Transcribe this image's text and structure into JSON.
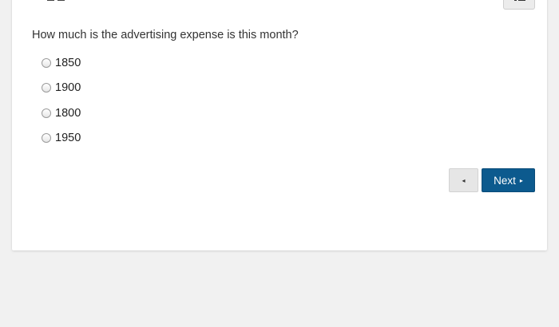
{
  "question": {
    "text": "How much is the advertising expense is this month?"
  },
  "options": [
    {
      "label": "1850",
      "selected": false
    },
    {
      "label": "1900",
      "selected": false
    },
    {
      "label": "1800",
      "selected": false
    },
    {
      "label": "1950",
      "selected": false
    }
  ],
  "navigation": {
    "prev_icon": "◂",
    "next_label": "Next",
    "next_icon": "▸"
  },
  "colors": {
    "page_background": "#f1f1f1",
    "card_background": "#ffffff",
    "primary_button": "#0c5a8e",
    "secondary_button": "#e6e6e6"
  }
}
